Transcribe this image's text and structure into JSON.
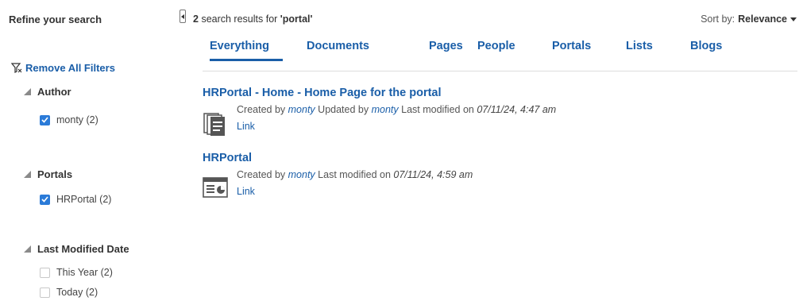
{
  "sidebar": {
    "title": "Refine your search",
    "remove_all": "Remove All Filters",
    "facets": [
      {
        "label": "Author",
        "options": [
          {
            "label": "monty (2)",
            "checked": true
          }
        ]
      },
      {
        "label": "Portals",
        "options": [
          {
            "label": "HRPortal (2)",
            "checked": true
          }
        ]
      },
      {
        "label": "Last Modified Date",
        "options": [
          {
            "label": "This Year (2)",
            "checked": false
          },
          {
            "label": "Today (2)",
            "checked": false
          }
        ]
      }
    ]
  },
  "header": {
    "count": "2",
    "results_for_text": "search results for",
    "query": "'portal'",
    "sort_label": "Sort by:",
    "sort_value": "Relevance"
  },
  "tabs": [
    {
      "label": "Everything",
      "active": true
    },
    {
      "label": "Documents",
      "active": false
    },
    {
      "label": "Pages",
      "active": false
    },
    {
      "label": "People",
      "active": false
    },
    {
      "label": "Portals",
      "active": false
    },
    {
      "label": "Lists",
      "active": false
    },
    {
      "label": "Blogs",
      "active": false
    }
  ],
  "results": [
    {
      "title": "HRPortal - Home - Home Page for the portal",
      "icon": "pages-icon",
      "created_by_label": "Created by",
      "created_by": "monty",
      "updated_by_label": "Updated by",
      "updated_by": "monty",
      "modified_label": "Last modified on",
      "modified": "07/11/24, 4:47 am",
      "link": "Link"
    },
    {
      "title": "HRPortal",
      "icon": "portal-icon",
      "created_by_label": "Created by",
      "created_by": "monty",
      "modified_label": "Last modified on",
      "modified": "07/11/24, 4:59 am",
      "link": "Link"
    }
  ],
  "colors": {
    "link": "#1a5ea8",
    "checkbox": "#2b7bd8",
    "text": "#333333"
  }
}
